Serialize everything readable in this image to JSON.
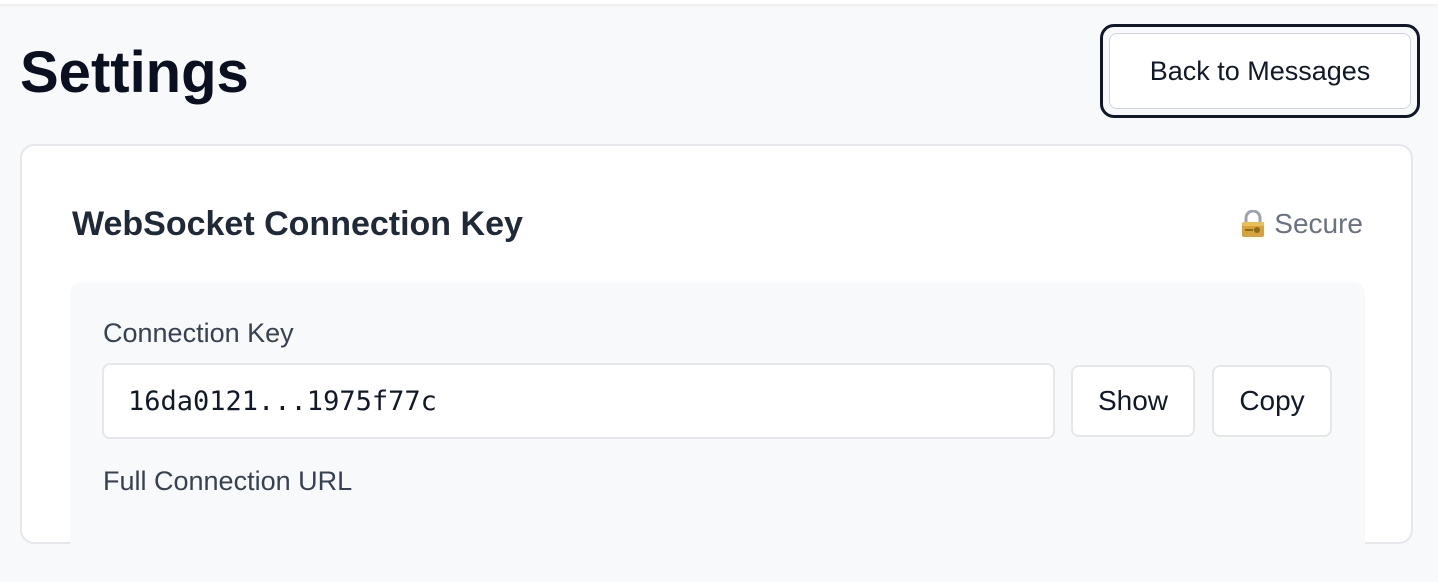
{
  "header": {
    "title": "Settings",
    "back_label": "Back to Messages"
  },
  "connection_card": {
    "title": "WebSocket Connection Key",
    "badge": {
      "icon": "lock-key-icon",
      "label": "Secure"
    },
    "key_field": {
      "label": "Connection Key",
      "value": "16da0121...1975f77c"
    },
    "show_label": "Show",
    "copy_label": "Copy",
    "url_field": {
      "label": "Full Connection URL"
    }
  }
}
